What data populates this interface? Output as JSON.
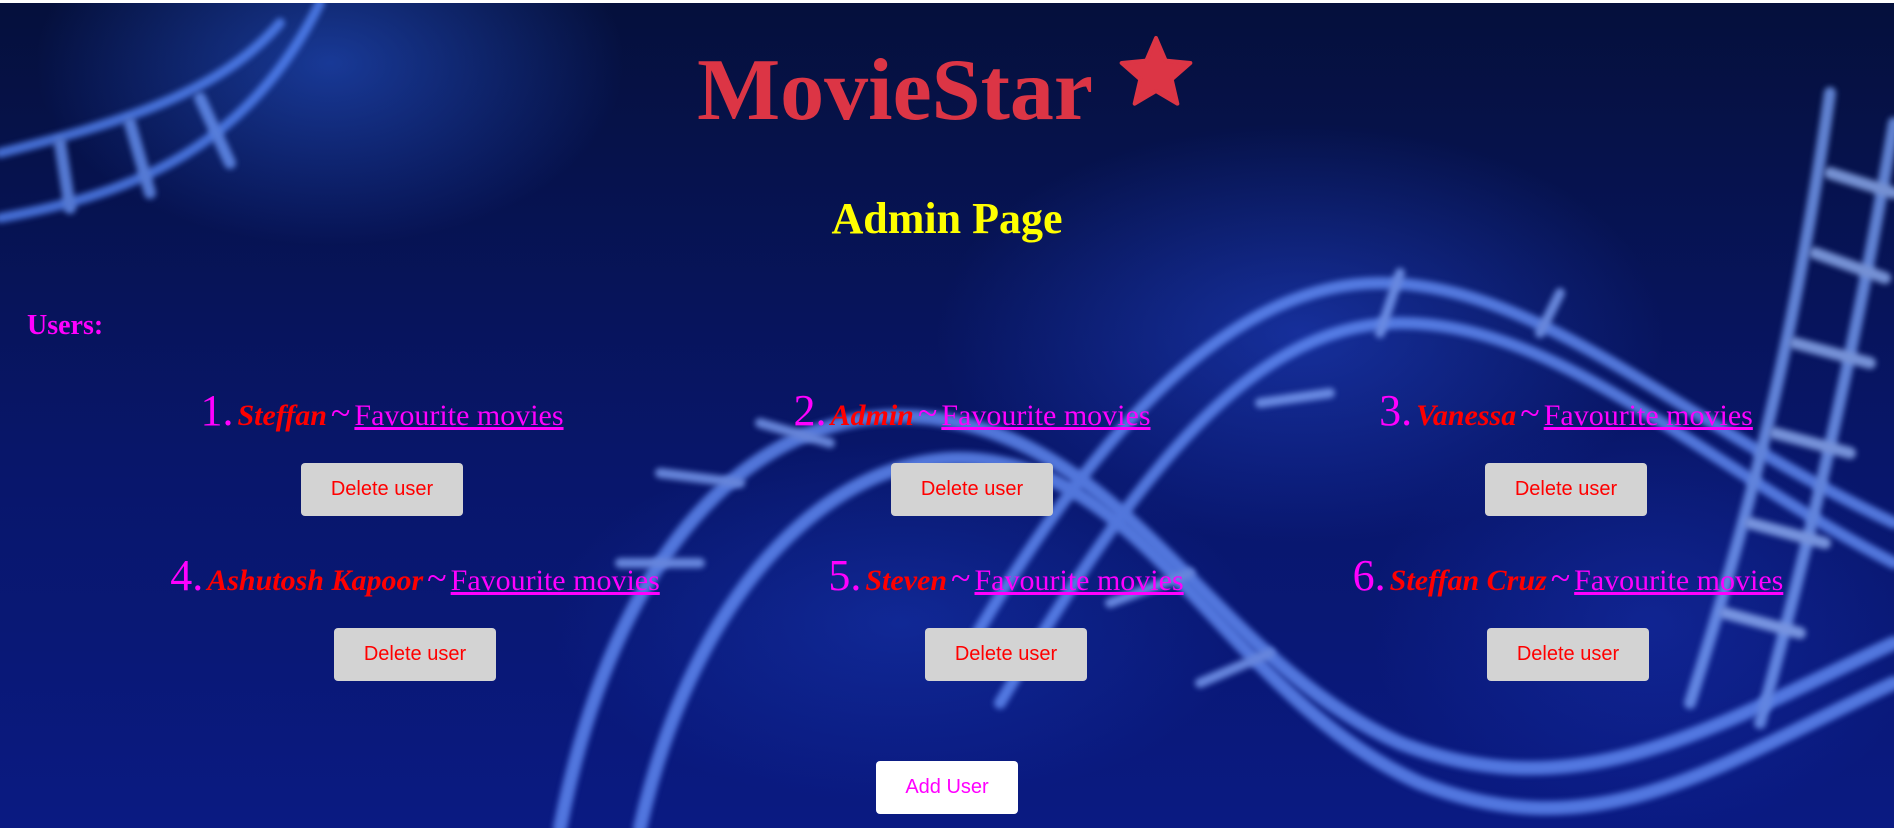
{
  "header": {
    "brand": "MovieStar",
    "brand_icon": "star-icon",
    "brand_color": "#dc3545"
  },
  "page_title": "Admin Page",
  "users_label": "Users:",
  "users": [
    {
      "index": "1.",
      "name": "Steffan",
      "separator": "~",
      "link_label": "Favourite movies",
      "delete_label": "Delete user"
    },
    {
      "index": "2.",
      "name": "Admin",
      "separator": "~",
      "link_label": "Favourite movies",
      "delete_label": "Delete user"
    },
    {
      "index": "3.",
      "name": "Vanessa",
      "separator": "~",
      "link_label": "Favourite movies",
      "delete_label": "Delete user"
    },
    {
      "index": "4.",
      "name": "Ashutosh Kapoor",
      "separator": "~",
      "link_label": "Favourite movies",
      "delete_label": "Delete user"
    },
    {
      "index": "5.",
      "name": "Steven",
      "separator": "~",
      "link_label": "Favourite movies",
      "delete_label": "Delete user"
    },
    {
      "index": "6.",
      "name": "Steffan Cruz",
      "separator": "~",
      "link_label": "Favourite movies",
      "delete_label": "Delete user"
    }
  ],
  "add_button_label": "Add User",
  "colors": {
    "title": "#ffff00",
    "label": "#ff00ff",
    "user_name": "#ff0000",
    "button_bg": "#d3d3d3"
  }
}
